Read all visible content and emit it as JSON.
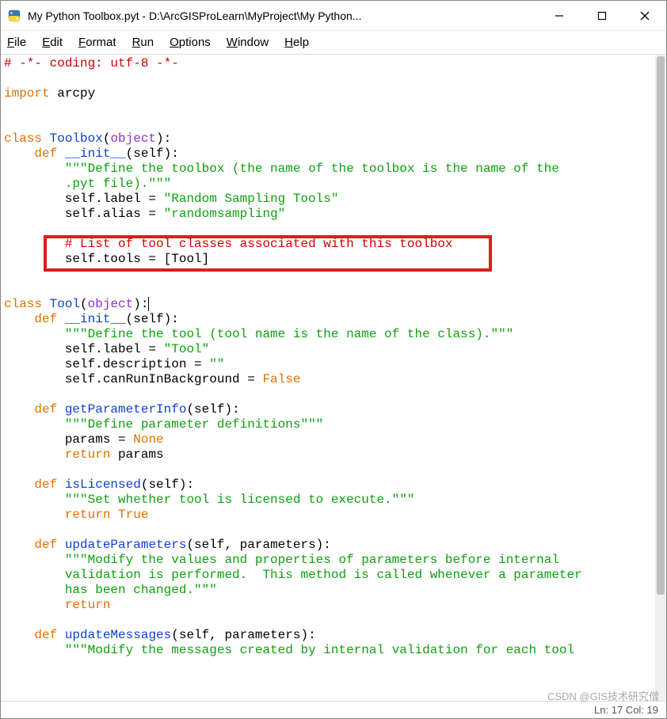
{
  "window": {
    "title": "My Python Toolbox.pyt - D:\\ArcGISProLearn\\MyProject\\My Python..."
  },
  "menubar": {
    "items": [
      {
        "u": "F",
        "rest": "ile"
      },
      {
        "u": "E",
        "rest": "dit"
      },
      {
        "u": "F",
        "rest": "ormat"
      },
      {
        "u": "R",
        "rest": "un"
      },
      {
        "u": "O",
        "rest": "ptions"
      },
      {
        "u": "W",
        "rest": "indow"
      },
      {
        "u": "H",
        "rest": "elp"
      }
    ]
  },
  "code": {
    "l01": "# -*- coding: utf-8 -*-",
    "l02": "",
    "l03a": "import",
    "l03b": " arcpy",
    "l04": "",
    "l05": "",
    "l06a": "class",
    "l06b": " Toolbox",
    "l06c": "(",
    "l06d": "object",
    "l06e": "):",
    "l07a": "    ",
    "l07b": "def",
    "l07c": " __init__",
    "l07d": "(self):",
    "l08a": "        ",
    "l08b": "\"\"\"Define the toolbox (the name of the toolbox is the name of the",
    "l09a": "        ",
    "l09b": ".pyt file).\"\"\"",
    "l10a": "        self.label = ",
    "l10b": "\"Random Sampling Tools\"",
    "l11a": "        self.alias = ",
    "l11b": "\"randomsampling\"",
    "l12": "",
    "l13a": "        ",
    "l13b": "# List of tool classes associated with this toolbox",
    "l14a": "        self.tools = [Tool]",
    "l15": "",
    "l16": "",
    "l17a": "class",
    "l17b": " Tool",
    "l17c": "(",
    "l17d": "object",
    "l17e": "):",
    "l18a": "    ",
    "l18b": "def",
    "l18c": " __init__",
    "l18d": "(self):",
    "l19a": "        ",
    "l19b": "\"\"\"Define the tool (tool name is the name of the class).\"\"\"",
    "l20a": "        self.label = ",
    "l20b": "\"Tool\"",
    "l21a": "        self.description = ",
    "l21b": "\"\"",
    "l22a": "        self.canRunInBackground = ",
    "l22b": "False",
    "l23": "",
    "l24a": "    ",
    "l24b": "def",
    "l24c": " getParameterInfo",
    "l24d": "(self):",
    "l25a": "        ",
    "l25b": "\"\"\"Define parameter definitions\"\"\"",
    "l26a": "        params = ",
    "l26b": "None",
    "l27a": "        ",
    "l27b": "return",
    "l27c": " params",
    "l28": "",
    "l29a": "    ",
    "l29b": "def",
    "l29c": " isLicensed",
    "l29d": "(self):",
    "l30a": "        ",
    "l30b": "\"\"\"Set whether tool is licensed to execute.\"\"\"",
    "l31a": "        ",
    "l31b": "return",
    "l31c": " ",
    "l31d": "True",
    "l32": "",
    "l33a": "    ",
    "l33b": "def",
    "l33c": " updateParameters",
    "l33d": "(self, parameters):",
    "l34a": "        ",
    "l34b": "\"\"\"Modify the values and properties of parameters before internal",
    "l35a": "        ",
    "l35b": "validation is performed.  This method is called whenever a parameter",
    "l36a": "        ",
    "l36b": "has been changed.\"\"\"",
    "l37a": "        ",
    "l37b": "return",
    "l38": "",
    "l39a": "    ",
    "l39b": "def",
    "l39c": " updateMessages",
    "l39d": "(self, parameters):",
    "l40a": "        ",
    "l40b": "\"\"\"Modify the messages created by internal validation for each tool"
  },
  "status": {
    "text": "Ln: 17  Col: 19"
  },
  "watermark": "CSDN @GIS技术研究僧"
}
